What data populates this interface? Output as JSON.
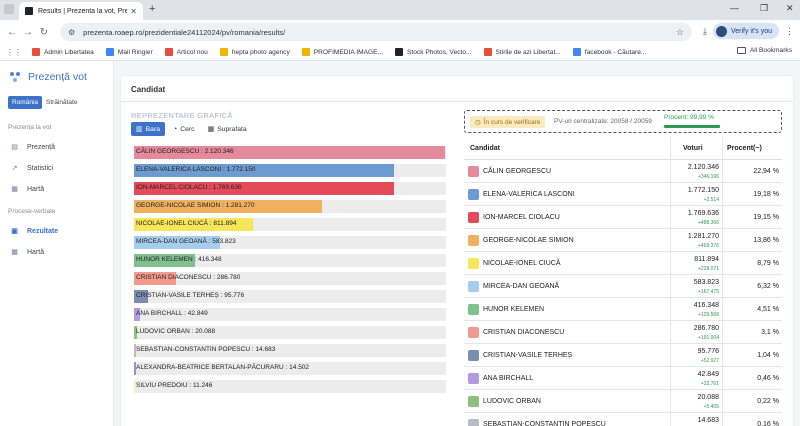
{
  "browser": {
    "tab_title": "Results | Prezenta la vot, Prezid",
    "url": "prezenta.roaep.ro/prezidentiale24112024/pv/romania/results/",
    "profile_label": "Verify it's you",
    "bookmarks": [
      {
        "label": "Admin Libertatea",
        "color": "#e74c3c"
      },
      {
        "label": "Mail Ringier",
        "color": "#4285f4"
      },
      {
        "label": "Articol nou",
        "color": "#e74c3c"
      },
      {
        "label": "hepta photo agency",
        "color": "#f0b400"
      },
      {
        "label": "PROFIMEDIA IMAGE...",
        "color": "#f0b400"
      },
      {
        "label": "Stock Photos, Vecto...",
        "color": "#222222"
      },
      {
        "label": "Stirile de azi Libertat...",
        "color": "#e74c3c"
      },
      {
        "label": "facebook - Căutare...",
        "color": "#4285f4"
      }
    ],
    "all_bookmarks": "All Bookmarks"
  },
  "sidebar": {
    "logo": "Prezență vot",
    "switch": [
      "România",
      "Străinătate"
    ],
    "section1": "Prezența la vot",
    "items1": [
      {
        "label": "Prezență",
        "icon": "chart-icon"
      },
      {
        "label": "Statistici",
        "icon": "trend-icon"
      },
      {
        "label": "Hartă",
        "icon": "map-icon"
      }
    ],
    "section2": "Procese-verbale",
    "items2": [
      {
        "label": "Rezultate",
        "icon": "results-icon"
      },
      {
        "label": "Hartă",
        "icon": "map-icon"
      }
    ]
  },
  "card": {
    "title": "Candidat",
    "rep_heading": "REPREZENTARE GRAFICĂ",
    "view_tabs": [
      "Bara",
      "Cerc",
      "Suprafata"
    ]
  },
  "status": {
    "badge": "În curs de verificare",
    "pv": "PV-uri centralizate: 20058 / 20059",
    "percent": "Procent: 99,99 %"
  },
  "table_headers": {
    "candidate": "Candidat",
    "votes": "Voturi",
    "percent": "Procent(~)"
  },
  "chart_data": {
    "type": "bar",
    "title": "",
    "categories": [
      "CĂLIN GEORGESCU",
      "ELENA-VALERICA LASCONI",
      "ION-MARCEL CIOLACU",
      "GEORGE-NICOLAE SIMION",
      "NICOLAE-IONEL CIUCĂ",
      "MIRCEA-DAN GEOANĂ",
      "HUNOR KELEMEN",
      "CRISTIAN DIACONESCU",
      "CRISTIAN-VASILE TERHEȘ",
      "ANA BIRCHALL",
      "LUDOVIC ORBAN",
      "SEBASTIAN-CONSTANTIN POPESCU",
      "ALEXANDRA-BEATRICE BERTALAN-PĂCURARU",
      "SILVIU PREDOIU"
    ],
    "values": [
      2120346,
      1772150,
      1769636,
      1281270,
      811894,
      583823,
      416348,
      286780,
      95776,
      42849,
      20088,
      14683,
      14502,
      11246
    ],
    "colors": [
      "#e58a9a",
      "#6c9bd2",
      "#e34a5a",
      "#f0b060",
      "#f7e55a",
      "#a6cdee",
      "#7fc08f",
      "#f39a8e",
      "#7a8db2",
      "#b39be0",
      "#8cc27a",
      "#b8bcc4",
      "#9f8fc9",
      "#f2efc9"
    ],
    "xlim": [
      0,
      2120346
    ]
  },
  "table_rows": [
    {
      "name": "CĂLIN GEORGESCU",
      "votes": "2.120.346",
      "delta": "+346,196",
      "percent": "22,94 %"
    },
    {
      "name": "ELENA-VALERICA LASCONI",
      "votes": "1.772.150",
      "delta": "+2.514",
      "percent": "19,18 %"
    },
    {
      "name": "ION-MARCEL CIOLACU",
      "votes": "1.769.636",
      "delta": "+488.366",
      "percent": "19,15 %"
    },
    {
      "name": "GEORGE-NICOLAE SIMION",
      "votes": "1.281.270",
      "delta": "+469.376",
      "percent": "13,86 %"
    },
    {
      "name": "NICOLAE-IONEL CIUCĂ",
      "votes": "811.894",
      "delta": "+228.071",
      "percent": "8,79 %"
    },
    {
      "name": "MIRCEA-DAN GEOANĂ",
      "votes": "583.823",
      "delta": "+167.475",
      "percent": "6,32 %"
    },
    {
      "name": "HUNOR KELEMEN",
      "votes": "416.348",
      "delta": "+129.568",
      "percent": "4,51 %"
    },
    {
      "name": "CRISTIAN DIACONESCU",
      "votes": "286.780",
      "delta": "+191.004",
      "percent": "3,1 %"
    },
    {
      "name": "CRISTIAN-VASILE TERHEȘ",
      "votes": "95.776",
      "delta": "+52.927",
      "percent": "1,04 %"
    },
    {
      "name": "ANA BIRCHALL",
      "votes": "42.849",
      "delta": "+22.761",
      "percent": "0,46 %"
    },
    {
      "name": "LUDOVIC ORBAN",
      "votes": "20.088",
      "delta": "+5.405",
      "percent": "0,22 %"
    },
    {
      "name": "SEBASTIAN-CONSTANTIN POPESCU",
      "votes": "14.683",
      "delta": "",
      "percent": "0,16 %"
    }
  ]
}
